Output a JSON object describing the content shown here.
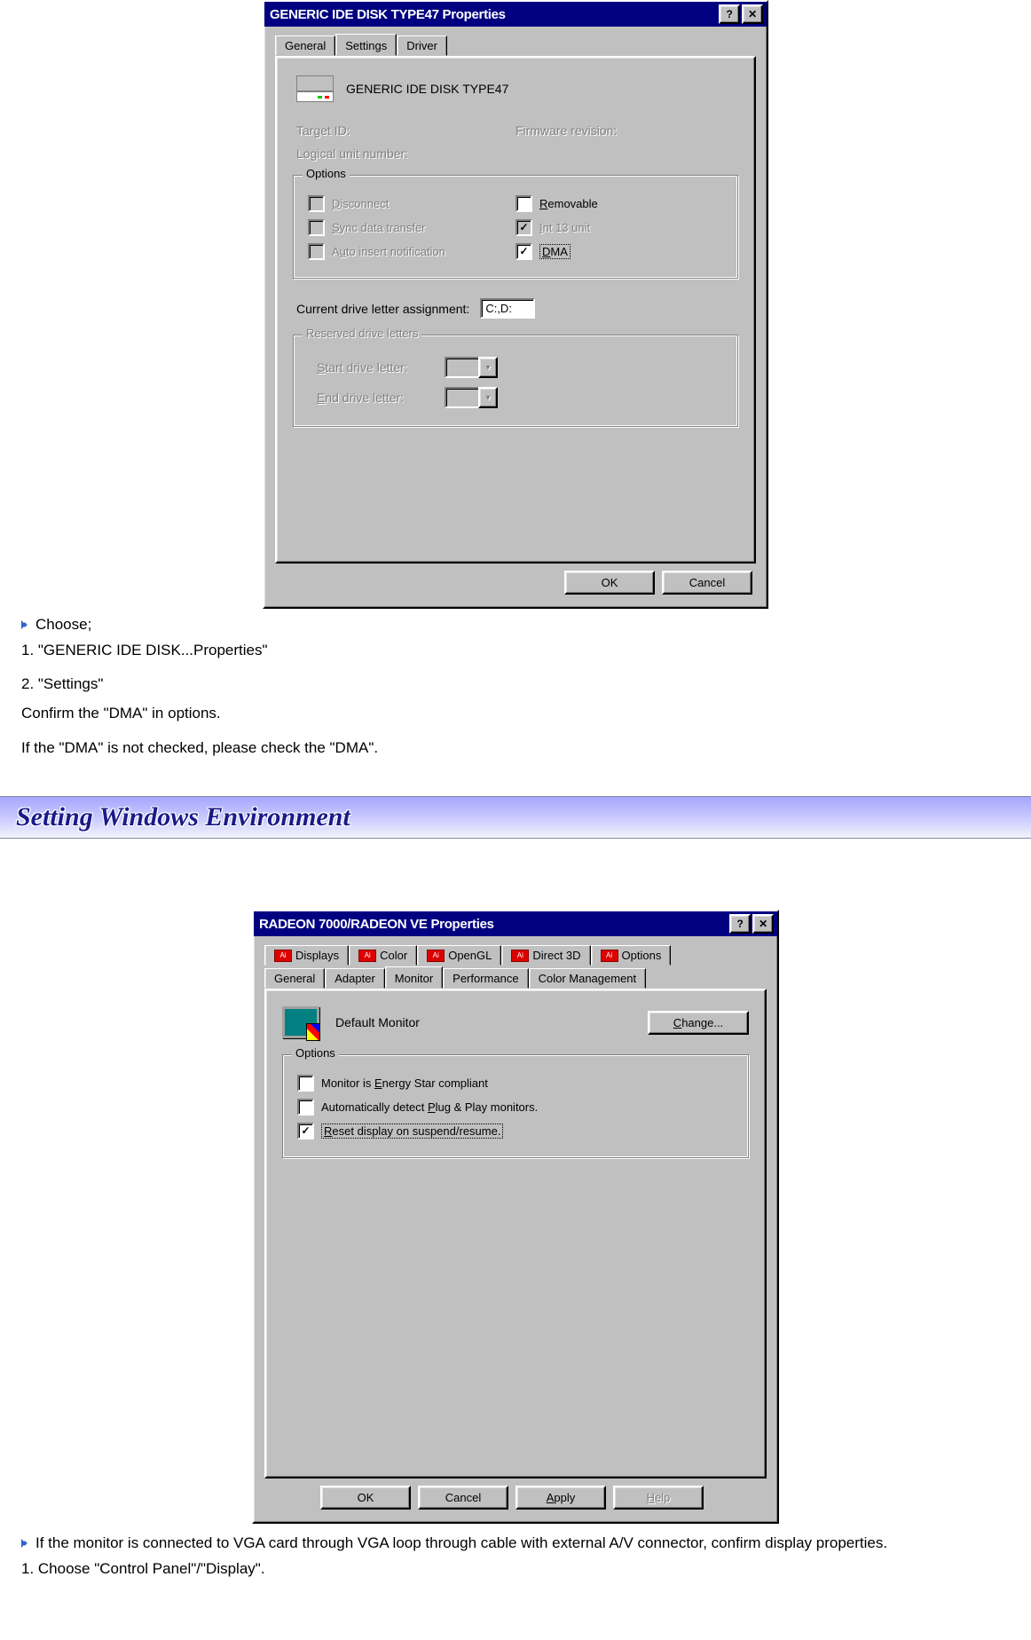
{
  "dlg1": {
    "title": "GENERIC IDE  DISK TYPE47 Properties",
    "tabs": {
      "general": "General",
      "settings": "Settings",
      "driver": "Driver"
    },
    "device_name": "GENERIC IDE  DISK TYPE47",
    "label_target_id": "Target ID:",
    "label_firmware": "Firmware revision:",
    "label_lun": "Logical unit number:",
    "options": {
      "legend": "Options",
      "disconnect": "Disconnect",
      "sync": "Sync data transfer",
      "auto": "Auto insert notification",
      "removable": "Removable",
      "int13": "Int 13 unit",
      "dma": "DMA"
    },
    "label_drive_assign": "Current drive letter assignment:",
    "drive_assign_value": "C:,D:",
    "reserved": {
      "legend": "Reserved drive letters",
      "start": "Start drive letter:",
      "end": "End drive letter:"
    },
    "btn_ok": "OK",
    "btn_cancel": "Cancel"
  },
  "doc1": {
    "l1": "Choose;",
    "l2": "1. \"GENERIC IDE DISK...Properties\"",
    "l3": "2. \"Settings\"",
    "l4": "Confirm the \"DMA\" in options.",
    "l5": "If the \"DMA\" is not checked, please check the \"DMA\"."
  },
  "banner": {
    "title": "Setting Windows Environment"
  },
  "dlg2": {
    "title": "RADEON 7000/RADEON VE  Properties",
    "tabs_top": {
      "displays": "Displays",
      "color": "Color",
      "opengl": "OpenGL",
      "direct3d": "Direct 3D",
      "options": "Options"
    },
    "tabs_bot": {
      "general": "General",
      "adapter": "Adapter",
      "monitor": "Monitor",
      "performance": "Performance",
      "colormgmt": "Color Management"
    },
    "monitor_name": "Default Monitor",
    "btn_change": "Change...",
    "options": {
      "legend": "Options",
      "opt1": "Monitor is Energy Star compliant",
      "opt2": "Automatically detect Plug & Play monitors.",
      "opt3": "Reset display on suspend/resume."
    },
    "btn_ok": "OK",
    "btn_cancel": "Cancel",
    "btn_apply": "Apply",
    "btn_help": "Help"
  },
  "doc2": {
    "l1": "If the monitor is connected to VGA card through VGA loop through cable with external A/V connector, confirm display properties.",
    "l2": "1. Choose \"Control Panel\"/\"Display\"."
  }
}
